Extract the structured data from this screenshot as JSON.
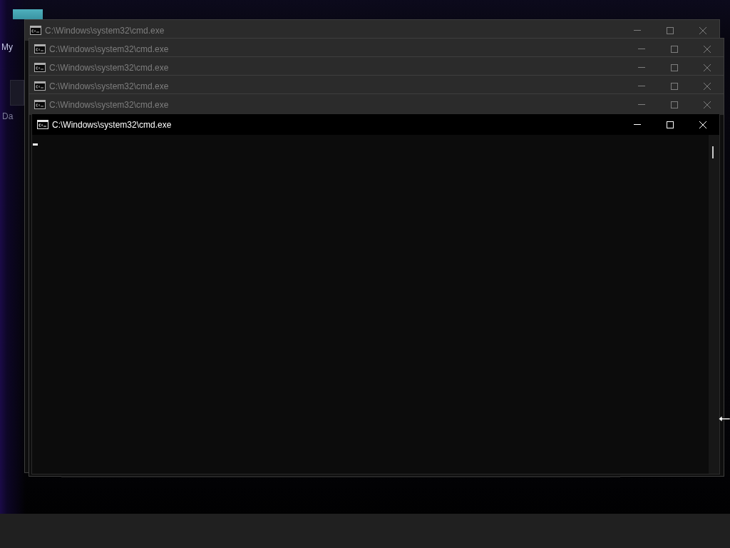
{
  "desktop_icons": [
    {
      "label": "My"
    },
    {
      "label": "Da"
    }
  ],
  "windows": [
    {
      "title": "C:\\Windows\\system32\\cmd.exe",
      "active": false
    },
    {
      "title": "C:\\Windows\\system32\\cmd.exe",
      "active": false
    },
    {
      "title": "C:\\Windows\\system32\\cmd.exe",
      "active": false
    },
    {
      "title": "C:\\Windows\\system32\\cmd.exe",
      "active": false
    },
    {
      "title": "C:\\Windows\\system32\\cmd.exe",
      "active": false
    },
    {
      "title": "C:\\Windows\\system32\\cmd.exe",
      "active": true
    }
  ]
}
